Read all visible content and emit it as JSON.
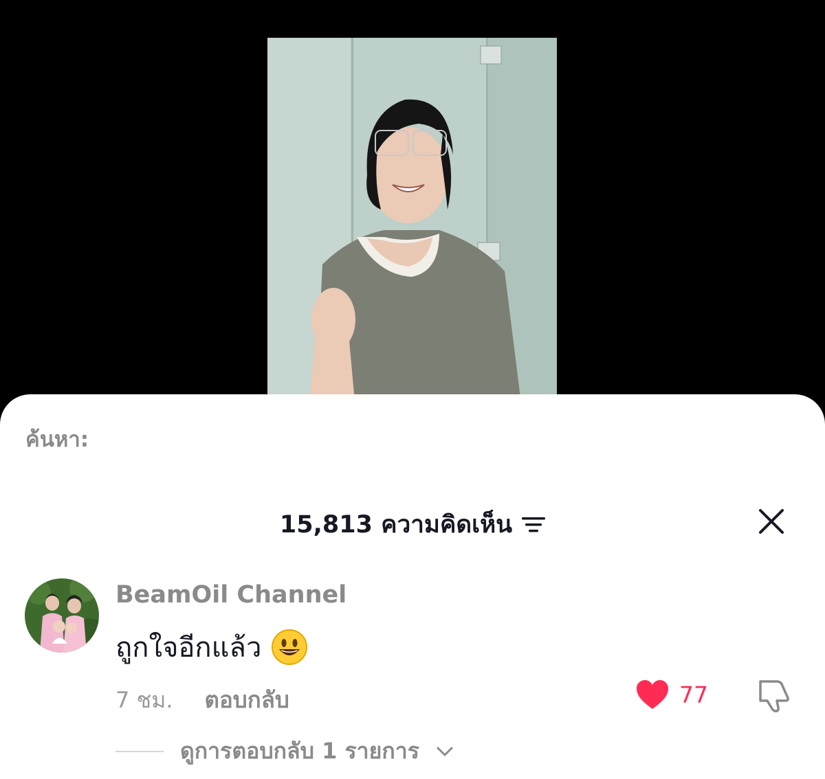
{
  "video": {
    "description_icon": "person-photo"
  },
  "search": {
    "label": "ค้นหา:"
  },
  "comments_panel": {
    "count_label": "15,813 ความคิดเห็น",
    "sort_icon": "filter-lines-icon",
    "close_icon": "close-icon"
  },
  "comment": {
    "username": "BeamOil Channel",
    "text": "ถูกใจอีกแล้ว",
    "emoji": "smiling-face-emoji",
    "time": "7 ชม.",
    "reply_label": "ตอบกลับ",
    "like_count": "77",
    "view_replies_label": "ดูการตอบกลับ 1 รายการ"
  },
  "colors": {
    "like": "#fe2c55",
    "muted": "#8a8a8a",
    "text": "#161823"
  }
}
